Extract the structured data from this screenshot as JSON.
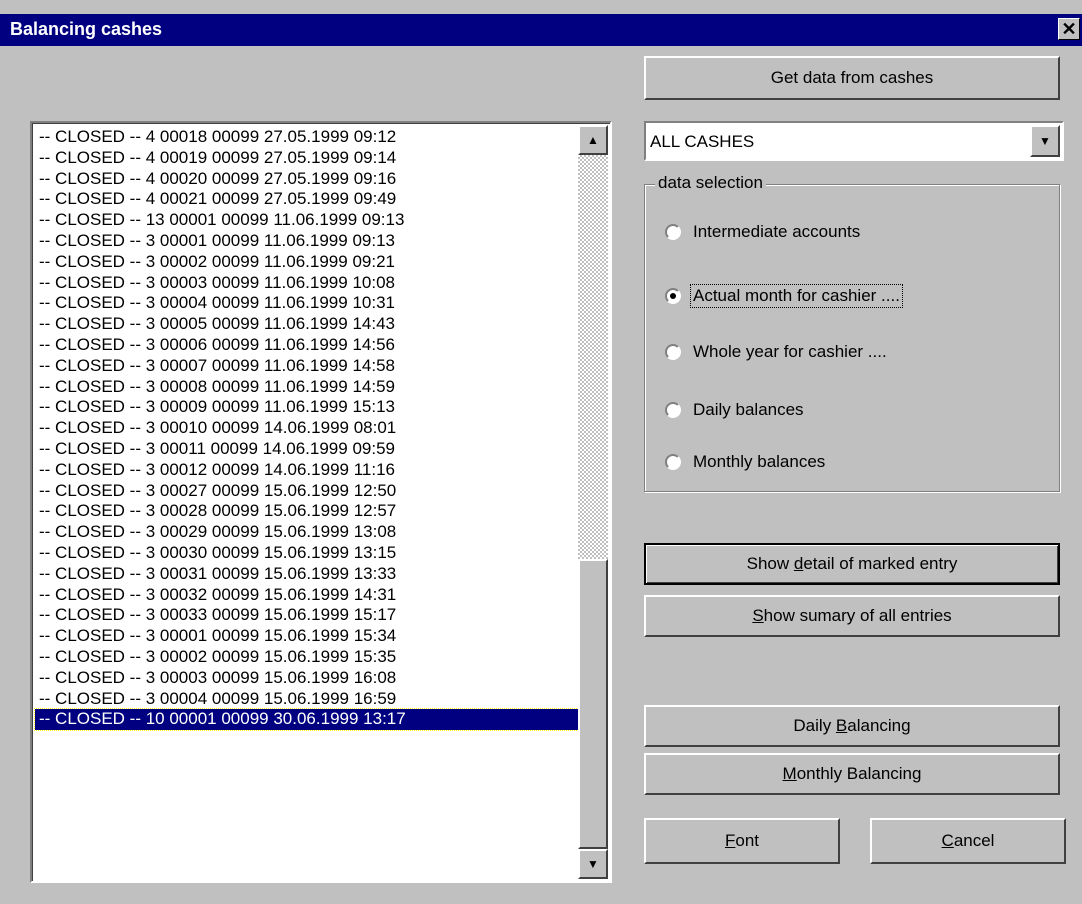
{
  "window": {
    "title": "Balancing cashes",
    "close_glyph": "✕"
  },
  "buttons": {
    "get_data": "Get data from cashes",
    "show_detail": {
      "pre": "Show ",
      "u": "d",
      "post": "etail of marked entry"
    },
    "show_summary": {
      "pre": "",
      "u": "S",
      "post": "how sumary of all entries"
    },
    "daily_balancing": {
      "pre": "Daily ",
      "u": "B",
      "post": "alancing"
    },
    "monthly_balancing": {
      "pre": "",
      "u": "M",
      "post": "onthly Balancing"
    },
    "font": {
      "pre": "",
      "u": "F",
      "post": "ont"
    },
    "cancel": {
      "pre": "",
      "u": "C",
      "post": "ancel"
    }
  },
  "combo": {
    "selected": "ALL CASHES"
  },
  "data_selection": {
    "label": "data selection",
    "options": [
      "Intermediate accounts",
      "Actual month for cashier ....",
      "Whole year for cashier ....",
      "Daily balances",
      "Monthly balances"
    ],
    "selected_index": 1
  },
  "list": {
    "items": [
      "-- CLOSED -- 4 00018 00099 27.05.1999 09:12",
      "-- CLOSED -- 4 00019 00099 27.05.1999 09:14",
      "-- CLOSED -- 4 00020 00099 27.05.1999 09:16",
      "-- CLOSED -- 4 00021 00099 27.05.1999 09:49",
      "-- CLOSED -- 13 00001 00099 11.06.1999 09:13",
      "-- CLOSED -- 3 00001 00099 11.06.1999 09:13",
      "-- CLOSED -- 3 00002 00099 11.06.1999 09:21",
      "-- CLOSED -- 3 00003 00099 11.06.1999 10:08",
      "-- CLOSED -- 3 00004 00099 11.06.1999 10:31",
      "-- CLOSED -- 3 00005 00099 11.06.1999 14:43",
      "-- CLOSED -- 3 00006 00099 11.06.1999 14:56",
      "-- CLOSED -- 3 00007 00099 11.06.1999 14:58",
      "-- CLOSED -- 3 00008 00099 11.06.1999 14:59",
      "-- CLOSED -- 3 00009 00099 11.06.1999 15:13",
      "-- CLOSED -- 3 00010 00099 14.06.1999 08:01",
      "-- CLOSED -- 3 00011 00099 14.06.1999 09:59",
      "-- CLOSED -- 3 00012 00099 14.06.1999 11:16",
      "-- CLOSED -- 3 00027 00099 15.06.1999 12:50",
      "-- CLOSED -- 3 00028 00099 15.06.1999 12:57",
      "-- CLOSED -- 3 00029 00099 15.06.1999 13:08",
      "-- CLOSED -- 3 00030 00099 15.06.1999 13:15",
      "-- CLOSED -- 3 00031 00099 15.06.1999 13:33",
      "-- CLOSED -- 3 00032 00099 15.06.1999 14:31",
      "-- CLOSED -- 3 00033 00099 15.06.1999 15:17",
      "-- CLOSED -- 3 00001 00099 15.06.1999 15:34",
      "-- CLOSED -- 3 00002 00099 15.06.1999 15:35",
      "-- CLOSED -- 3 00003 00099 15.06.1999 16:08",
      "-- CLOSED -- 3 00004 00099 15.06.1999 16:59",
      "-- CLOSED -- 10 00001 00099 30.06.1999 13:17"
    ],
    "selected_index": 28
  },
  "colors": {
    "titlebar": "#000080",
    "selection": "#000080",
    "face": "#c0c0c0"
  }
}
